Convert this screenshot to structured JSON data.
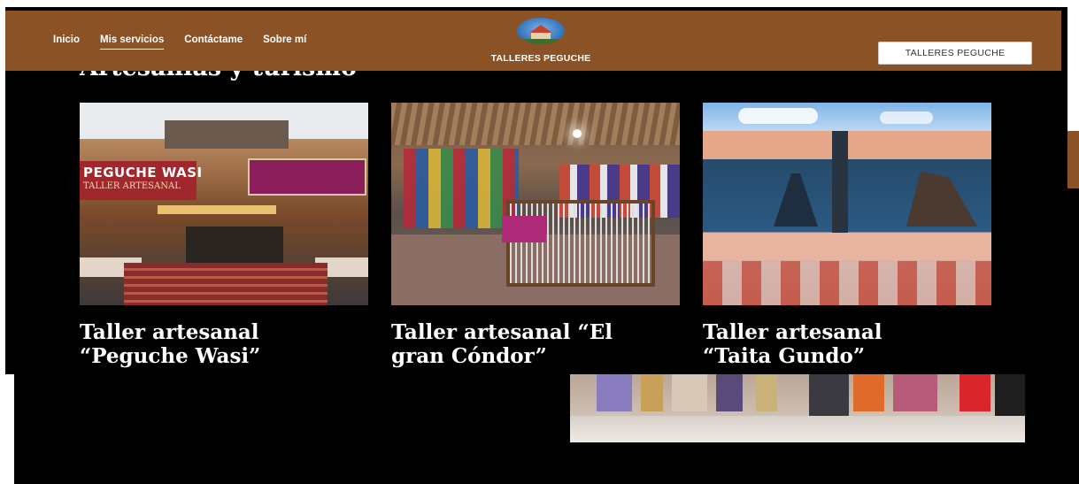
{
  "navbar": {
    "links": [
      {
        "label": "Inicio",
        "active": false
      },
      {
        "label": "Mis servicios",
        "active": true
      },
      {
        "label": "Contáctame",
        "active": false
      },
      {
        "label": "Sobre mí",
        "active": false
      }
    ],
    "brand": "TALLERES PEGUCHE",
    "button_label": "TALLERES PEGUCHE",
    "bg_color": "#8b5325"
  },
  "section": {
    "heading": "Artesanías y turismo"
  },
  "cards": [
    {
      "title_line1": "Taller artesanal",
      "title_line2": "“Peguche Wasi”",
      "photo": {
        "sign_text": "PEGUCHE WASI",
        "sign_sub": "TALLER ARTESANAL"
      }
    },
    {
      "title_line1": "Taller artesanal “El",
      "title_line2": "gran Cóndor”"
    },
    {
      "title_line1": "Taller artesanal",
      "title_line2": "“Taita Gundo”"
    }
  ]
}
